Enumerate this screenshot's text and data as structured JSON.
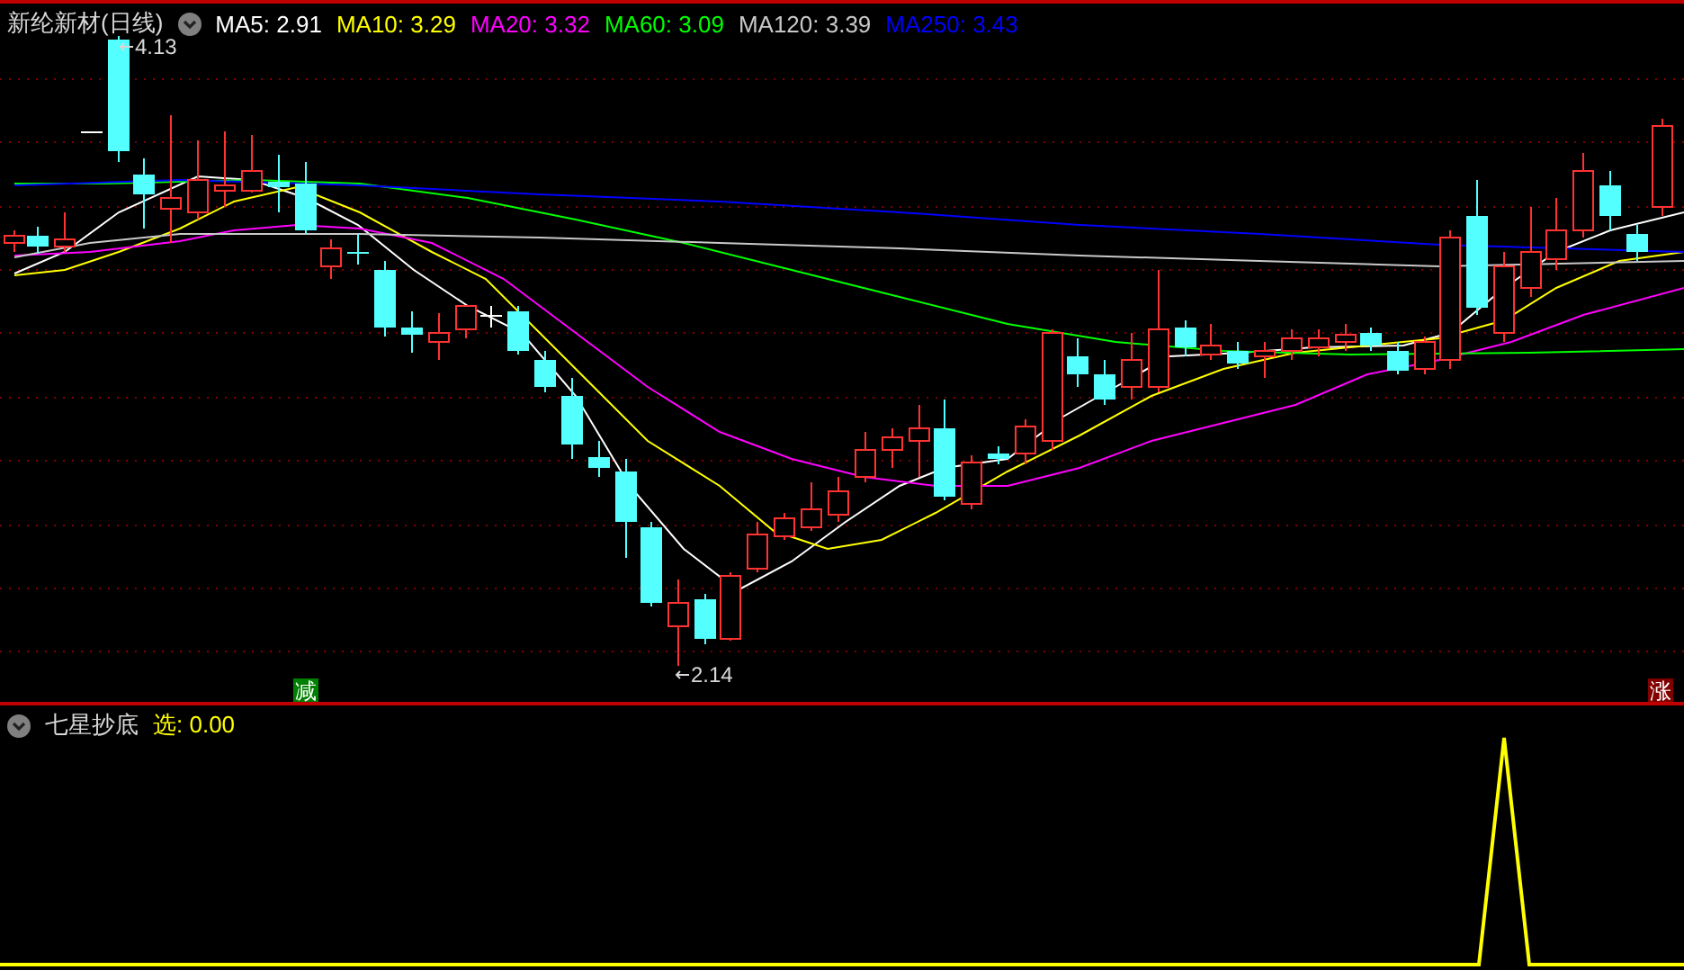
{
  "main_pane": {
    "title": "新纶新材(日线)",
    "indicators": [
      {
        "label": "MA5: 2.91",
        "color": "#ffffff"
      },
      {
        "label": "MA10: 3.29",
        "color": "#ffff00"
      },
      {
        "label": "MA20: 3.32",
        "color": "#ff00ff"
      },
      {
        "label": "MA60: 3.09",
        "color": "#00ff00"
      },
      {
        "label": "MA120: 3.39",
        "color": "#c8c8c8"
      },
      {
        "label": "MA250: 3.43",
        "color": "#0000ff"
      }
    ],
    "high_label": "4.13",
    "low_label": "2.14",
    "signals": [
      {
        "text": "减",
        "color": "#008000"
      },
      {
        "text": "涨",
        "color": "#800000"
      }
    ]
  },
  "sub_pane": {
    "title": "七星抄底",
    "indicators": [
      {
        "label": "选: 0.00",
        "color": "#ffff00"
      }
    ]
  }
}
